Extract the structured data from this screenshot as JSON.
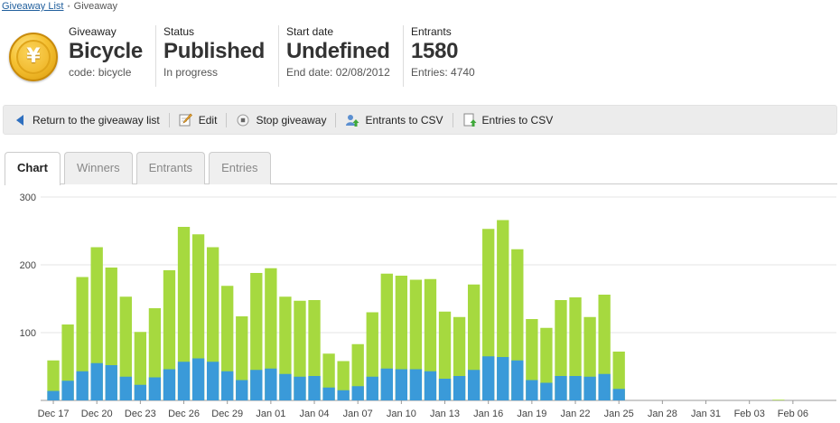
{
  "breadcrumb": {
    "link": "Giveaway List",
    "current": "Giveaway"
  },
  "logo": {
    "symbol": "¥"
  },
  "stats": {
    "giveaway": {
      "label": "Giveaway",
      "value": "Bicycle",
      "sub": "code: bicycle"
    },
    "status": {
      "label": "Status",
      "value": "Published",
      "sub": "In progress"
    },
    "start": {
      "label": "Start date",
      "value": "Undefined",
      "sub": "End date: 02/08/2012"
    },
    "entrants": {
      "label": "Entrants",
      "value": "1580",
      "sub": "Entries: 4740"
    }
  },
  "toolbar": {
    "return_label": "Return to the giveaway list",
    "edit_label": "Edit",
    "stop_label": "Stop giveaway",
    "entrants_csv_label": "Entrants to CSV",
    "entries_csv_label": "Entries to CSV"
  },
  "tabs": [
    {
      "label": "Chart"
    },
    {
      "label": "Winners"
    },
    {
      "label": "Entrants"
    },
    {
      "label": "Entries"
    }
  ],
  "colors": {
    "entrants": "#3a9ad9",
    "entries": "#a6d93f",
    "grid": "#e6e6e6",
    "axis": "#999999"
  },
  "chart_data": {
    "type": "bar",
    "stacked": true,
    "ylim": [
      0,
      300
    ],
    "yticks": [
      0,
      100,
      200,
      300
    ],
    "ytick_labels": [
      "",
      "100",
      "200",
      "300"
    ],
    "x_tick_labels": [
      "Dec 17",
      "Dec 20",
      "Dec 23",
      "Dec 26",
      "Dec 29",
      "Jan 01",
      "Jan 04",
      "Jan 07",
      "Jan 10",
      "Jan 13",
      "Jan 16",
      "Jan 19",
      "Jan 22",
      "Jan 25",
      "Jan 28",
      "Jan 31",
      "Feb 03",
      "Feb 06"
    ],
    "series": [
      {
        "values": [
          14,
          29,
          43,
          55,
          52,
          35,
          23,
          34,
          46,
          57,
          62,
          57,
          43,
          30,
          45,
          47,
          39,
          35,
          36,
          19,
          15,
          21,
          35,
          47,
          46,
          46,
          43,
          32,
          36,
          45,
          65,
          64,
          59,
          30,
          26,
          36,
          36,
          35,
          39,
          17,
          0,
          0,
          0,
          0,
          0,
          0,
          0,
          0,
          0,
          0,
          0,
          0,
          0,
          0
        ]
      },
      {
        "values": [
          59,
          112,
          182,
          226,
          196,
          153,
          101,
          136,
          192,
          256,
          245,
          226,
          169,
          124,
          188,
          195,
          153,
          147,
          148,
          69,
          58,
          83,
          130,
          187,
          184,
          178,
          179,
          131,
          123,
          171,
          253,
          266,
          223,
          120,
          107,
          148,
          152,
          123,
          156,
          72,
          0,
          0,
          0,
          0,
          0,
          0,
          0,
          0,
          0,
          0,
          1,
          0,
          0,
          0
        ]
      }
    ]
  }
}
